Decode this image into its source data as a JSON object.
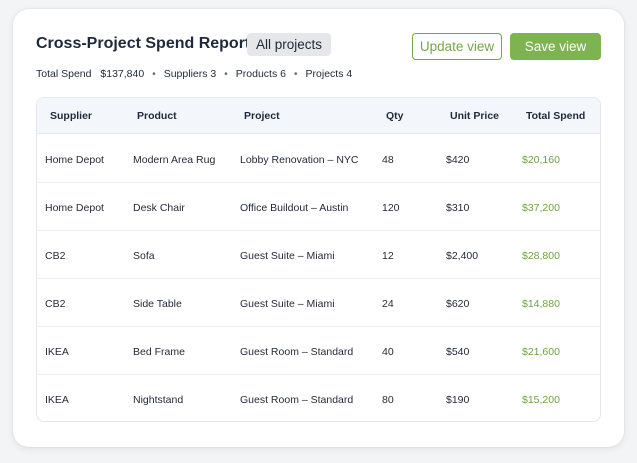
{
  "header": {
    "title": "Cross-Project Spend Report",
    "filter_chip": "All projects",
    "update_button": "Update view",
    "save_button": "Save view"
  },
  "summary": {
    "total_spend_label": "Total Spend",
    "total_spend_value": "$137,840",
    "suppliers": "Suppliers 3",
    "products": "Products 6",
    "projects": "Projects 4",
    "separator": "•"
  },
  "table": {
    "columns": [
      "Supplier",
      "Product",
      "Project",
      "Qty",
      "Unit Price",
      "Total Spend"
    ],
    "rows": [
      [
        "Home Depot",
        "Modern Area Rug",
        "Lobby Renovation – NYC",
        "48",
        "$420",
        "$20,160"
      ],
      [
        "Home Depot",
        "Desk Chair",
        "Office Buildout – Austin",
        "120",
        "$310",
        "$37,200"
      ],
      [
        "CB2",
        "Sofa",
        "Guest Suite – Miami",
        "12",
        "$2,400",
        "$28,800"
      ],
      [
        "CB2",
        "Side Table",
        "Guest Suite – Miami",
        "24",
        "$620",
        "$14,880"
      ],
      [
        "IKEA",
        "Bed Frame",
        "Guest Room – Standard",
        "40",
        "$540",
        "$21,600"
      ],
      [
        "IKEA",
        "Nightstand",
        "Guest Room – Standard",
        "80",
        "$190",
        "$15,200"
      ]
    ]
  },
  "colors": {
    "accent_green": "#7db351",
    "total_green": "#6fa142"
  }
}
